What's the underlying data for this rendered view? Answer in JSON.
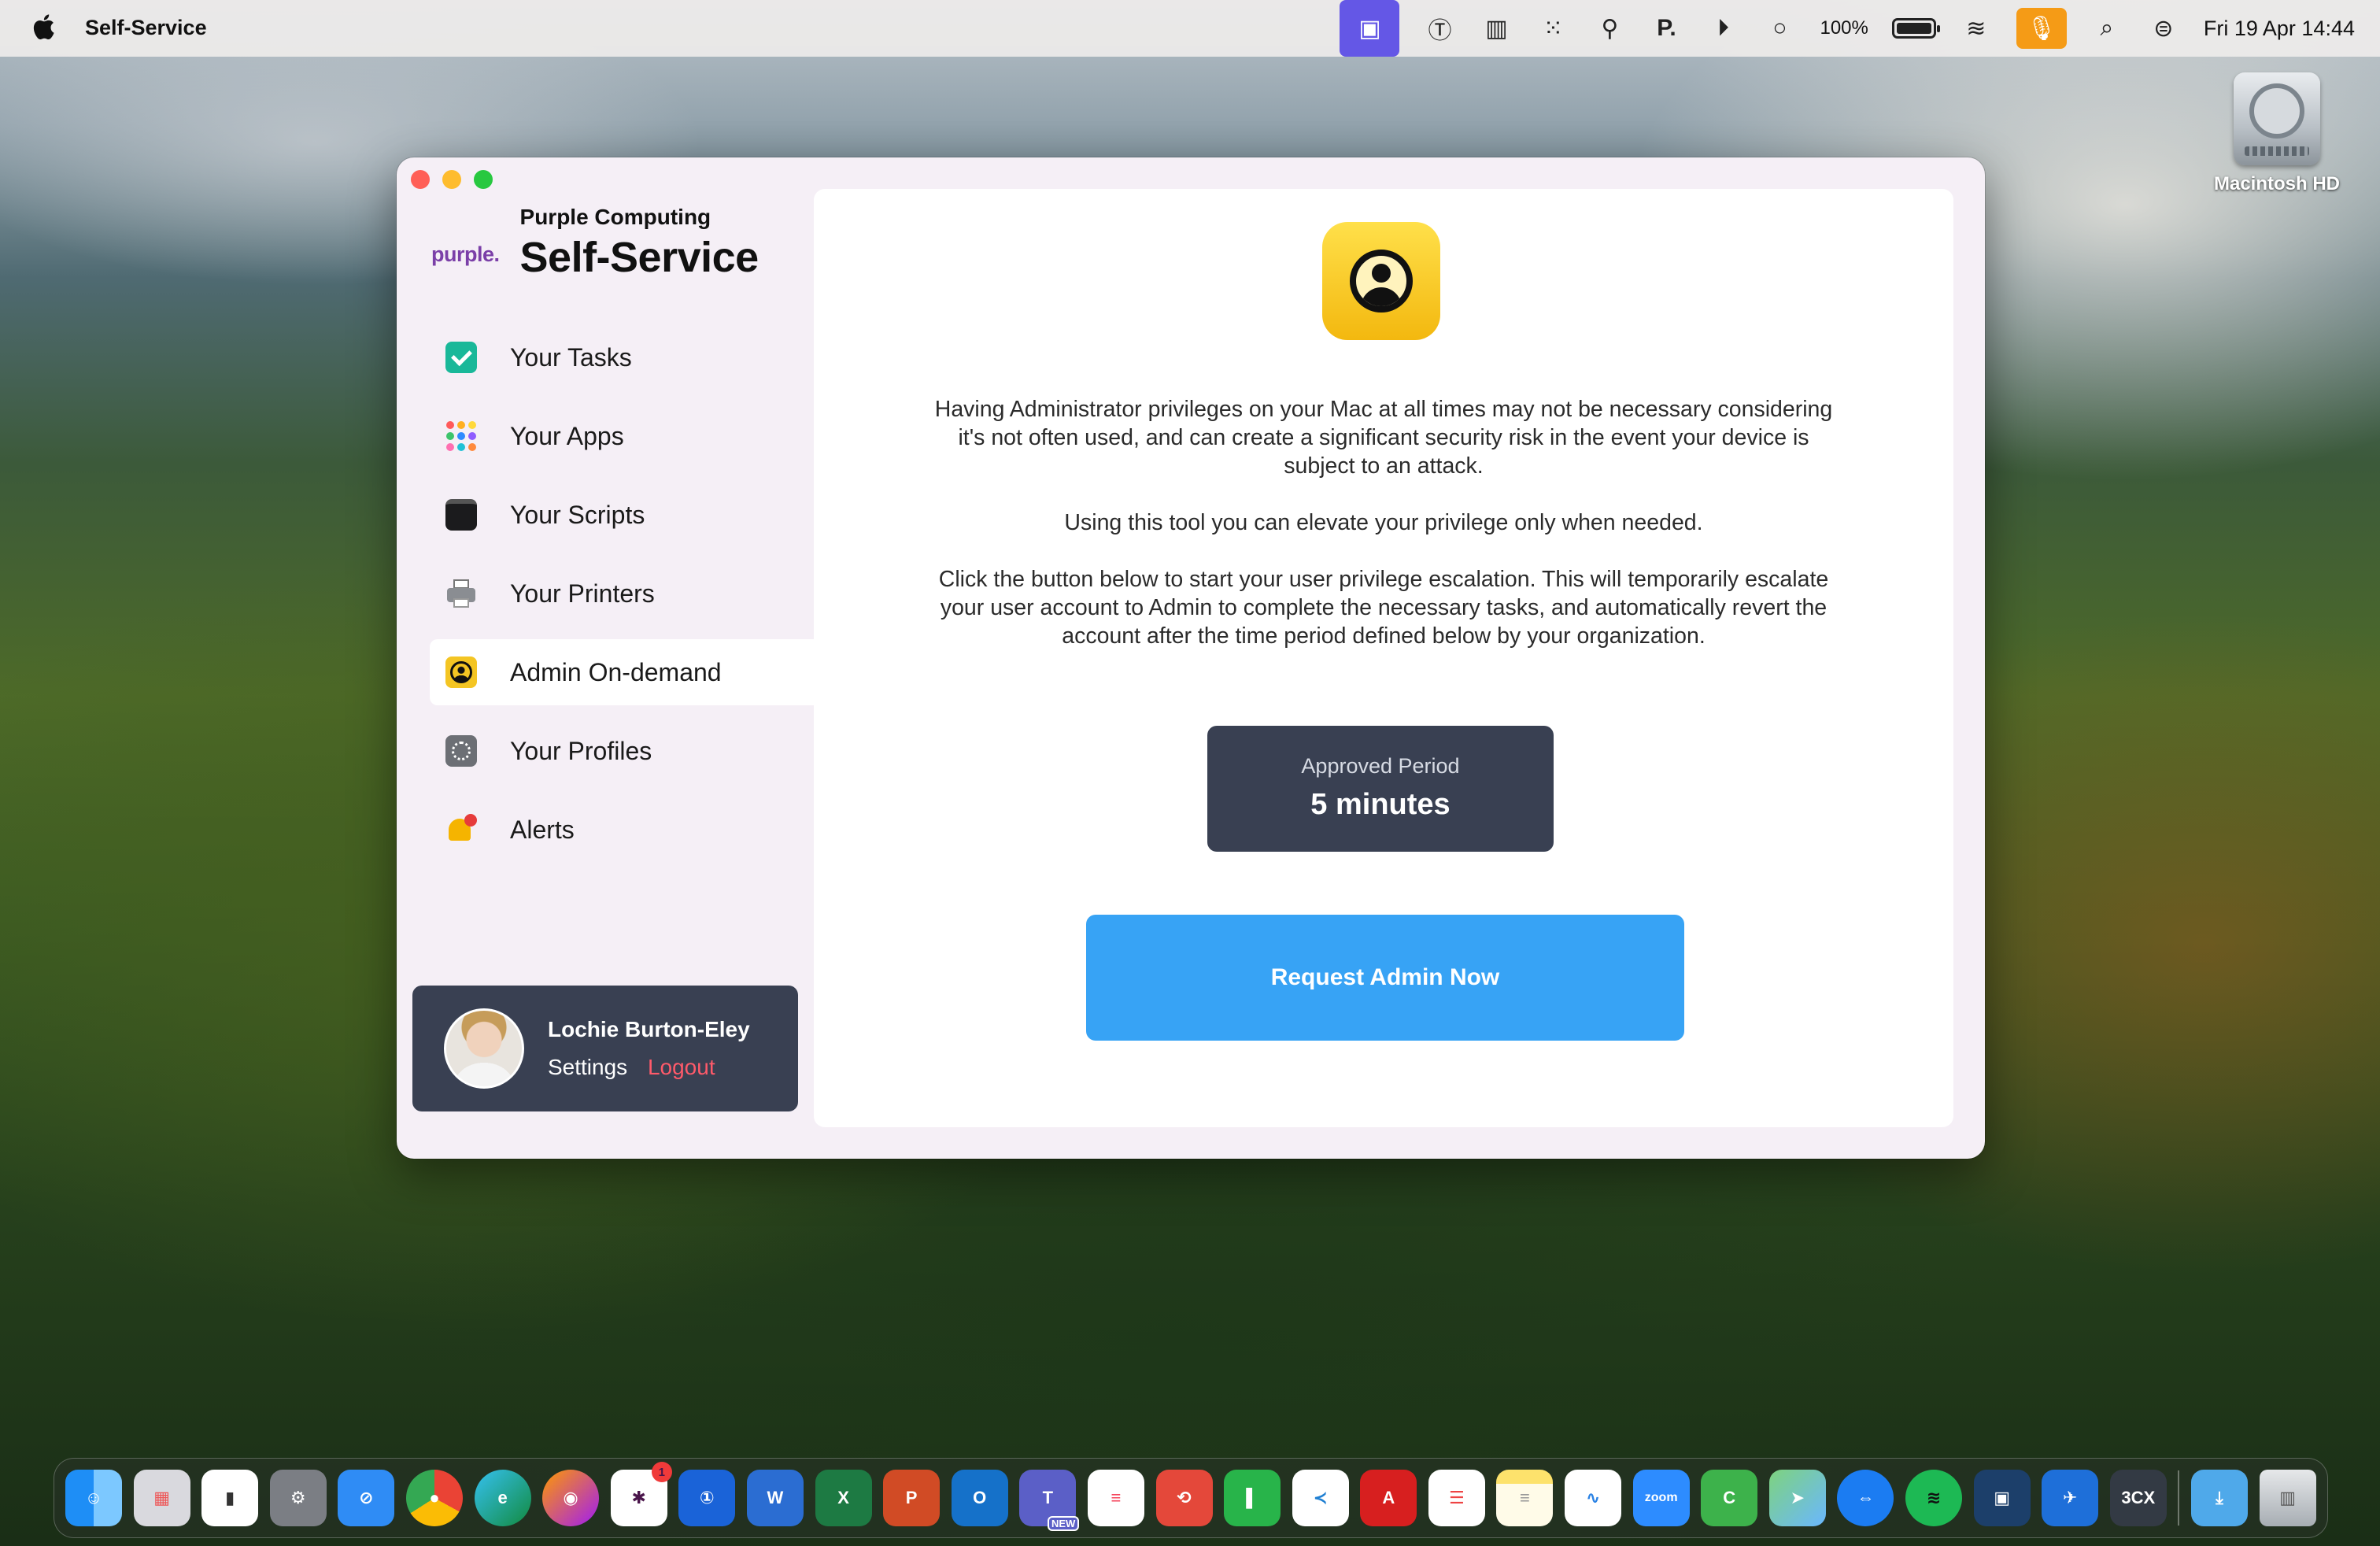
{
  "menubar": {
    "app_name": "Self-Service",
    "battery": "100%",
    "clock": "Fri 19 Apr  14:44"
  },
  "desktop": {
    "disk_label": "Macintosh HD"
  },
  "sidebar": {
    "logo_text": "purple.",
    "org": "Purple Computing",
    "title": "Self-Service",
    "items": [
      {
        "label": "Your Tasks",
        "icon": "checkbox-icon"
      },
      {
        "label": "Your Apps",
        "icon": "apps-grid-icon"
      },
      {
        "label": "Your Scripts",
        "icon": "terminal-icon"
      },
      {
        "label": "Your Printers",
        "icon": "printer-icon"
      },
      {
        "label": "Admin On-demand",
        "icon": "admin-user-icon"
      },
      {
        "label": "Your Profiles",
        "icon": "profile-gear-icon"
      },
      {
        "label": "Alerts",
        "icon": "bell-icon"
      }
    ],
    "selected_index": 4,
    "user": {
      "name": "Lochie Burton-Eley",
      "settings": "Settings",
      "logout": "Logout"
    }
  },
  "main": {
    "paragraphs": [
      "Having Administrator privileges on your Mac at all times may not be necessary considering it's not often used, and can create a significant security risk in the event your device is subject to an attack.",
      "Using this tool you can elevate your privilege only when needed.",
      "Click the button below to start your user privilege escalation. This will temporarily escalate your user account to Admin to complete the necessary tasks, and automatically revert the account after the time period defined below by your organization."
    ],
    "period_label": "Approved Period",
    "period_value": "5 minutes",
    "request_button": "Request Admin Now"
  },
  "dock": {
    "teams_badge": "NEW",
    "slack_badge": "1",
    "zoom_label": "zoom",
    "threecx_label": "3CX"
  },
  "colors": {
    "accent_blue": "#37a3f5",
    "card_dark": "#394052",
    "logout_red": "#ff5a6a",
    "admin_yellow": "#f4c523",
    "brand_purple": "#7b3fa8"
  }
}
